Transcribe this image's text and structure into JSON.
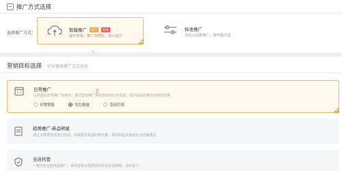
{
  "mode_section": {
    "title": "推广方式选择",
    "field_label": "选择推广方式：",
    "options": [
      {
        "title": "智能推广",
        "badges": [
          "推荐",
          "新版"
        ],
        "desc": "操作简单，推广效果好，省心省力",
        "selected": true
      },
      {
        "title": "标准推广",
        "badges": [],
        "desc": "自定义设置推广，操作更灵活",
        "selected": false
      }
    ],
    "marker": "1"
  },
  "goal_section": {
    "title": "营销目标选择",
    "subtitle": "针对营销推广方式优化",
    "marker": "2",
    "goals": [
      {
        "title": "日常推广",
        "desc": "以商品的日常推广为目标，通过智能推广系统自动出价并投放，提升商品的曝光与转化效果",
        "selected": true,
        "radios": [
          {
            "label": "日常销售",
            "checked": false
          },
          {
            "label": "均匀投放",
            "checked": true
          },
          {
            "label": "活动引流",
            "checked": false
          }
        ]
      },
      {
        "title": "趋势推广-新品明星",
        "desc": "通过大数据发现潜力商品，快速提升新品的曝光量，帮助商品快速成长为店铺爆品",
        "selected": false
      },
      {
        "title": "全店托管",
        "desc": "一键托管全店商品推广，系统智能分配预算并优化投放策略，省时省力",
        "selected": false
      }
    ]
  },
  "colors": {
    "accent": "#f3b56a",
    "accent_dark": "#f0a23c",
    "badge_orange": "#ff9a2e",
    "badge_red": "#ff4d4f"
  }
}
